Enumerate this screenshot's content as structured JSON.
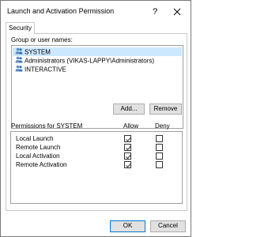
{
  "window": {
    "title": "Launch and Activation Permission",
    "help_glyph": "?",
    "accent_color": "#0078d7",
    "selection_color": "#cce8ff"
  },
  "tabs": [
    {
      "label": "Security",
      "selected": true
    }
  ],
  "security": {
    "group_label": "Group or user names:",
    "users": [
      {
        "name": "SYSTEM",
        "icon": "users-group-icon",
        "selected": true
      },
      {
        "name": "Administrators (VIKAS-LAPPY\\Administrators)",
        "icon": "users-group-icon",
        "selected": false
      },
      {
        "name": "INTERACTIVE",
        "icon": "users-group-icon",
        "selected": false
      }
    ],
    "add_label": "Add...",
    "remove_label": "Remove",
    "permissions_label": "Permissions for SYSTEM",
    "allow_header": "Allow",
    "deny_header": "Deny",
    "permissions": [
      {
        "name": "Local Launch",
        "allow": true,
        "deny": false
      },
      {
        "name": "Remote Launch",
        "allow": true,
        "deny": false
      },
      {
        "name": "Local Activation",
        "allow": true,
        "deny": false
      },
      {
        "name": "Remote Activation",
        "allow": true,
        "deny": false
      }
    ]
  },
  "footer": {
    "ok_label": "OK",
    "cancel_label": "Cancel"
  }
}
